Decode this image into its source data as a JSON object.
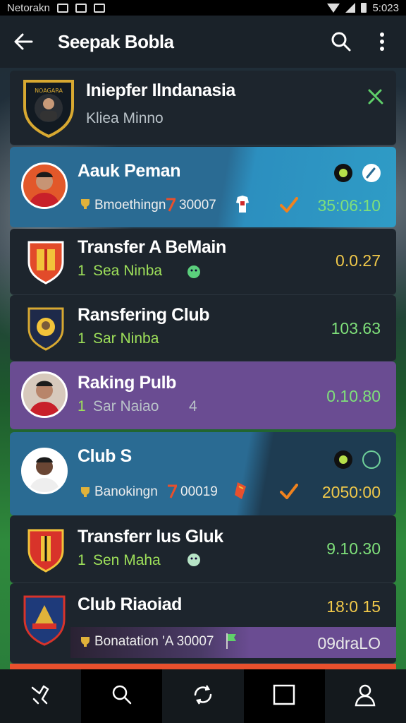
{
  "status_bar": {
    "carrier": "Netorakn",
    "time": "5:023"
  },
  "app_bar": {
    "title": "Seepak Bobla"
  },
  "header_card": {
    "title": "Iniepfer Ilndanasia",
    "subtitle": "Kliea Minno"
  },
  "rows": [
    {
      "title": "Aauk Peman",
      "sub": "Bmoethingn",
      "sub2": "30007",
      "value": "35:06:10"
    },
    {
      "title": "Transfer A BeMain",
      "sub_prefix": "1",
      "sub": "Sea Ninba",
      "value": "0.0.27"
    },
    {
      "title": "Ransfering Club",
      "sub_prefix": "1",
      "sub": "Sar Ninba",
      "value": "103.63"
    },
    {
      "title": "Raking Pulb",
      "sub_prefix": "1",
      "sub": "Sar Naiao",
      "sub2": "4",
      "value": "0.10.80"
    },
    {
      "title": "Club S",
      "sub": "Banokingn",
      "sub2": "00019",
      "value": "2050:00"
    },
    {
      "title": "Transferr lus Gluk",
      "sub_prefix": "1",
      "sub": "Sen Maha",
      "value": "9.10.30"
    },
    {
      "title": "Club Riaoiad",
      "value": "18:0 15",
      "sub": "Bonatation 'A 30007",
      "value2": "09draLO"
    }
  ],
  "colors": {
    "accent_green": "#9ee05a",
    "value_yellow": "#f1c94a",
    "highlight_blue": "#2a6b93",
    "highlight_purple": "#6a4c92",
    "orange": "#e8502d"
  },
  "icons": {
    "back": "arrow-left-icon",
    "search": "search-icon",
    "more": "more-vert-icon",
    "nav": [
      "shoe-icon",
      "search-icon",
      "refresh-icon",
      "square-icon",
      "profile-icon"
    ]
  }
}
